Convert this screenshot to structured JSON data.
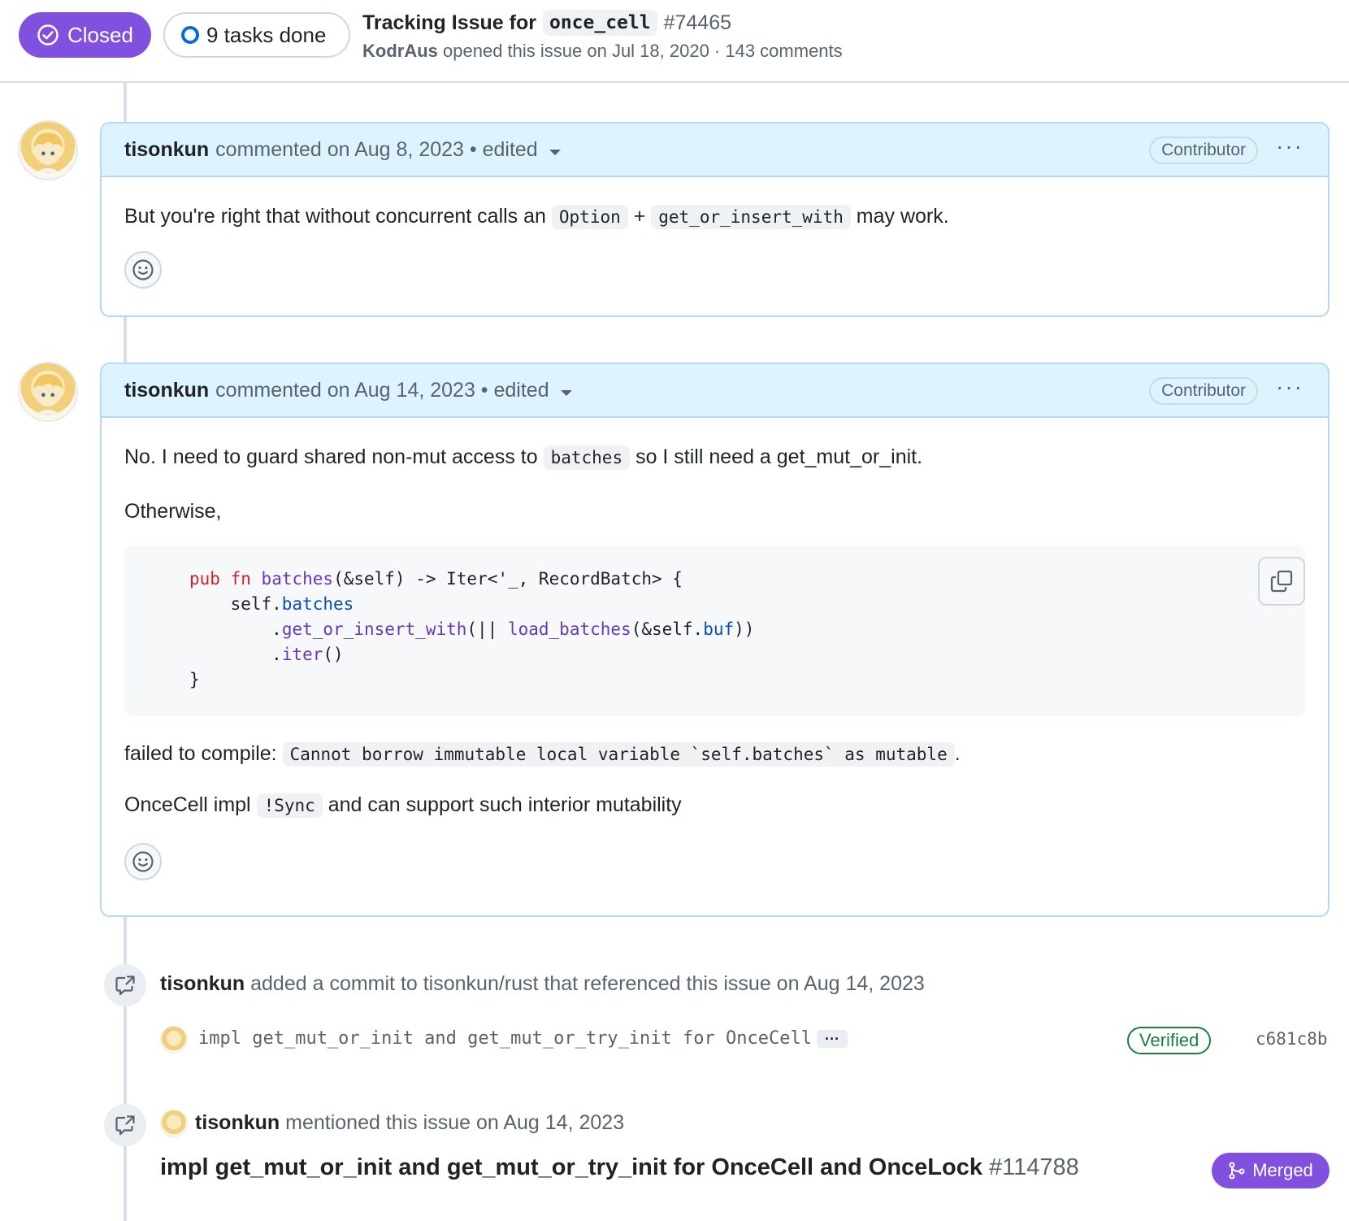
{
  "issue": {
    "state": "Closed",
    "tasks": "9 tasks done",
    "title_prefix": "Tracking Issue for",
    "title_code": "once_cell",
    "number": "#74465",
    "opener": "KodrAus",
    "opened_text": "opened this issue on Jul 18, 2020 · 143 comments"
  },
  "comments": [
    {
      "author": "tisonkun",
      "meta": "commented on Aug 8, 2023 • edited",
      "role": "Contributor",
      "menu": "···",
      "body": {
        "t1": "But you're right that without concurrent calls an",
        "c1": "Option",
        "t2": "+",
        "c2": "get_or_insert_with",
        "t3": "may work."
      }
    },
    {
      "author": "tisonkun",
      "meta": "commented on Aug 14, 2023 • edited",
      "role": "Contributor",
      "menu": "···",
      "body": {
        "p1_t1": "No. I need to guard shared non-mut access to",
        "p1_c1": "batches",
        "p1_t2": "so I still need a get_mut_or_init.",
        "p2": "Otherwise,",
        "code": {
          "l1_kw1": "pub",
          "l1_kw2": "fn",
          "l1_fn": "batches",
          "l1_rest": "(&self) -> Iter<'_, RecordBatch> {",
          "l2_a": "self.",
          "l2_b": "batches",
          "l3_a": ".",
          "l3_b": "get_or_insert_with",
          "l3_c": "(|| ",
          "l3_d": "load_batches",
          "l3_e": "(&self.",
          "l3_f": "buf",
          "l3_g": "))",
          "l4_a": ".",
          "l4_b": "iter",
          "l4_c": "()",
          "l5": "}"
        },
        "p3_t1": "failed to compile:",
        "p3_c1": "Cannot borrow immutable local variable `self.batches` as mutable",
        "p3_t2": ".",
        "p4_t1": "OnceCell impl",
        "p4_c1": "!Sync",
        "p4_t2": "and can support such interior mutability"
      }
    }
  ],
  "events": [
    {
      "author": "tisonkun",
      "text": "added a commit to tisonkun/rust that referenced this issue on Aug 14, 2023",
      "commit_message": "impl get_mut_or_init and get_mut_or_try_init for OnceCell",
      "commit_more": "···",
      "verified": "Verified",
      "sha": "c681c8b"
    },
    {
      "author": "tisonkun",
      "text": "mentioned this issue on Aug 14, 2023",
      "pr_title": "impl get_mut_or_init and get_mut_or_try_init for OnceCell and OnceLock",
      "pr_number": "#114788",
      "pr_state": "Merged"
    }
  ],
  "colors": {
    "closed": "#8250df",
    "merged": "#8250df",
    "verified": "#1a7f37",
    "comment_header": "#ddf4ff",
    "comment_border": "#b6d7f5"
  },
  "icons": [
    "check-circle-icon",
    "task-ring-icon",
    "smiley-icon",
    "copy-icon",
    "cross-reference-icon",
    "git-merge-icon",
    "kebab-icon",
    "caret-down-icon"
  ]
}
